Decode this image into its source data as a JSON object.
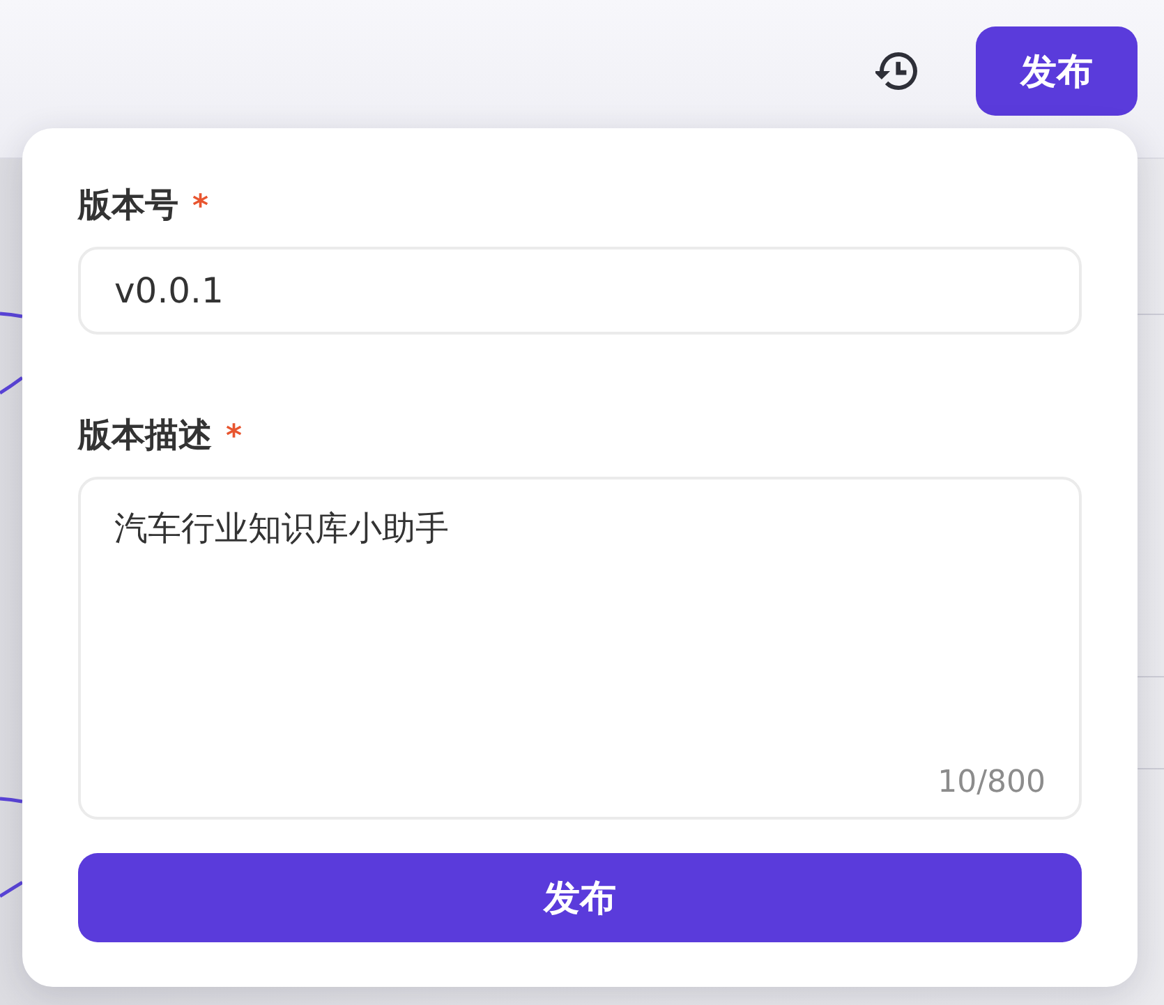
{
  "toolbar": {
    "publish_button": "发布"
  },
  "publish_popover": {
    "fields": [
      {
        "kind": "input",
        "label": "版本号",
        "required_mark": "*",
        "value": "v0.0.1"
      },
      {
        "kind": "textarea",
        "label": "版本描述",
        "required_mark": "*",
        "value": "汽车行业知识库小助手",
        "counter": "10/800"
      }
    ],
    "submit_button": "发布"
  }
}
